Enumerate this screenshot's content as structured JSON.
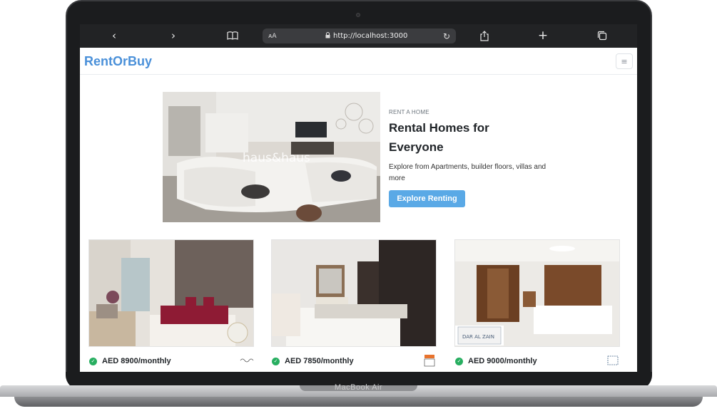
{
  "device": {
    "model_label": "MacBook Air"
  },
  "browser": {
    "address_prefix": "ᴀA",
    "url": "http://localhost:3000",
    "icons": [
      "back-icon",
      "forward-icon",
      "book-icon",
      "lock-icon",
      "reload-icon",
      "share-icon",
      "new-tab-icon",
      "tabs-icon"
    ]
  },
  "site": {
    "brand": "RentOrBuy",
    "brand_color": "#4a90d9",
    "menu_icon": "hamburger-icon"
  },
  "hero": {
    "kicker": "RENT A HOME",
    "title": "Rental Homes for Everyone",
    "description": "Explore from Apartments, builder floors, villas and more",
    "button_label": "Explore Renting",
    "button_color": "#5aa9e6",
    "image_watermark": "haus&haus"
  },
  "listings": [
    {
      "price": "AED 8900/monthly",
      "verified_icon": "check-circle-icon",
      "agency_logo": "agency-logo-icon"
    },
    {
      "price": "AED 7850/monthly",
      "verified_icon": "check-circle-icon",
      "agency_logo": "agency-logo-icon"
    },
    {
      "price": "AED 9000/monthly",
      "verified_icon": "check-circle-icon",
      "agency_logo": "agency-logo-icon",
      "image_watermark": "DAR AL ZAIN"
    }
  ]
}
